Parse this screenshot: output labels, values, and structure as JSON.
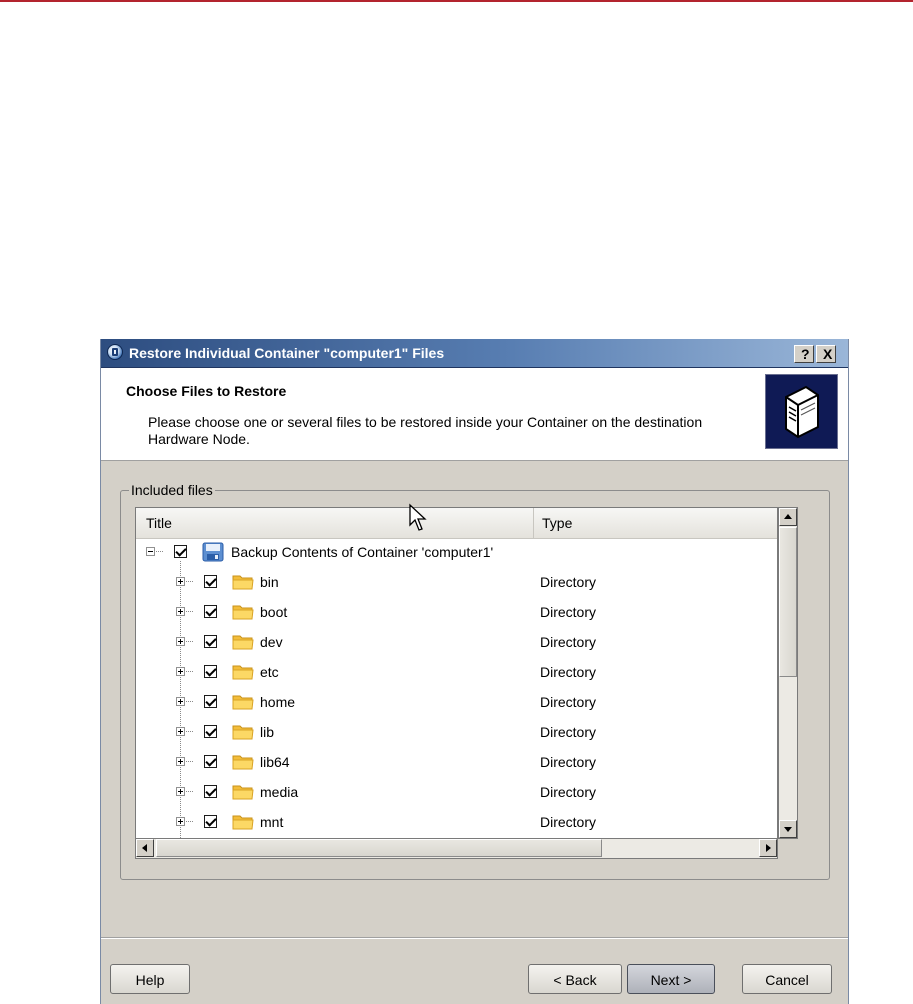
{
  "window": {
    "title": "Restore Individual Container \"computer1\" Files",
    "help_glyph": "?",
    "close_glyph": "X"
  },
  "header": {
    "title": "Choose Files to Restore",
    "description": "Please choose one or several files to be restored inside your Container on the destination Hardware Node."
  },
  "group": {
    "label": "Included files"
  },
  "tree": {
    "columns": {
      "title": "Title",
      "type": "Type"
    },
    "root": {
      "label": "Backup Contents of Container 'computer1'",
      "checked": true,
      "expanded": true,
      "icon": "backup-container-icon"
    },
    "items": [
      {
        "name": "bin",
        "type": "Directory",
        "checked": true,
        "icon": "folder-icon"
      },
      {
        "name": "boot",
        "type": "Directory",
        "checked": true,
        "icon": "folder-icon"
      },
      {
        "name": "dev",
        "type": "Directory",
        "checked": true,
        "icon": "folder-icon"
      },
      {
        "name": "etc",
        "type": "Directory",
        "checked": true,
        "icon": "folder-icon"
      },
      {
        "name": "home",
        "type": "Directory",
        "checked": true,
        "icon": "folder-icon"
      },
      {
        "name": "lib",
        "type": "Directory",
        "checked": true,
        "icon": "folder-icon"
      },
      {
        "name": "lib64",
        "type": "Directory",
        "checked": true,
        "icon": "folder-icon"
      },
      {
        "name": "media",
        "type": "Directory",
        "checked": true,
        "icon": "folder-icon"
      },
      {
        "name": "mnt",
        "type": "Directory",
        "checked": true,
        "icon": "folder-icon"
      }
    ]
  },
  "buttons": {
    "help": "Help",
    "back": "< Back",
    "next": "Next >",
    "cancel": "Cancel"
  },
  "colors": {
    "accent_rule": "#b3242e",
    "titlebar_start": "#2d4d80",
    "titlebar_end": "#9ab6d8",
    "dialog_face": "#d4d0c8",
    "folder": "#f5c542"
  }
}
